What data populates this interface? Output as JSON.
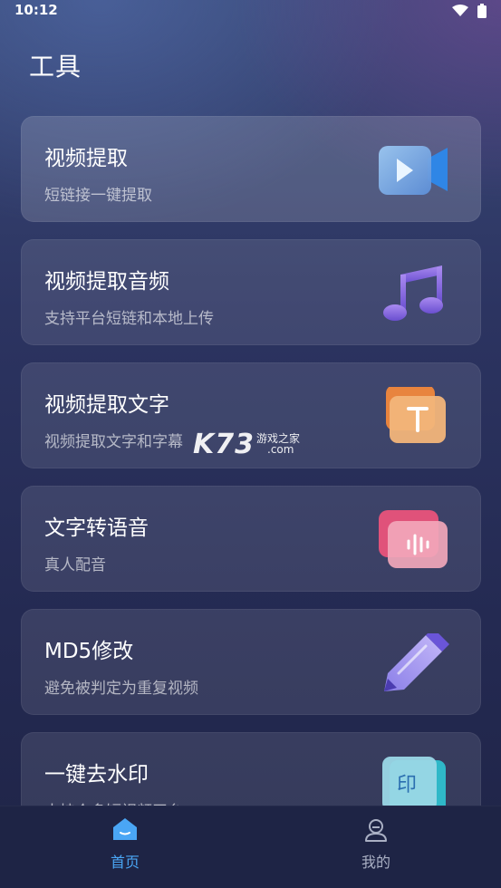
{
  "status_bar": {
    "time": "10:12",
    "icons": [
      "wifi-icon",
      "battery-icon"
    ]
  },
  "page": {
    "title": "工具"
  },
  "tools": [
    {
      "title": "视频提取",
      "subtitle": "短链接一键提取",
      "icon": "video-camera-icon"
    },
    {
      "title": "视频提取音频",
      "subtitle": "支持平台短链和本地上传",
      "icon": "music-note-icon"
    },
    {
      "title": "视频提取文字",
      "subtitle": "视频提取文字和字幕",
      "icon": "text-t-icon"
    },
    {
      "title": "文字转语音",
      "subtitle": "真人配音",
      "icon": "sound-wave-icon"
    },
    {
      "title": "MD5修改",
      "subtitle": "避免被判定为重复视频",
      "icon": "pencil-icon"
    },
    {
      "title": "一键去水印",
      "subtitle": "支持众多短视频平台",
      "icon": "stamp-icon"
    }
  ],
  "watermark": {
    "brand": "K73",
    "line1": "游戏之家",
    "line2": ".com"
  },
  "bottom_nav": {
    "items": [
      {
        "label": "首页",
        "icon": "home-icon",
        "active": true
      },
      {
        "label": "我的",
        "icon": "profile-icon",
        "active": false
      }
    ]
  },
  "colors": {
    "accent": "#4aa6f5",
    "background": "#242a52",
    "card": "rgba(255,255,255,0.10)"
  }
}
